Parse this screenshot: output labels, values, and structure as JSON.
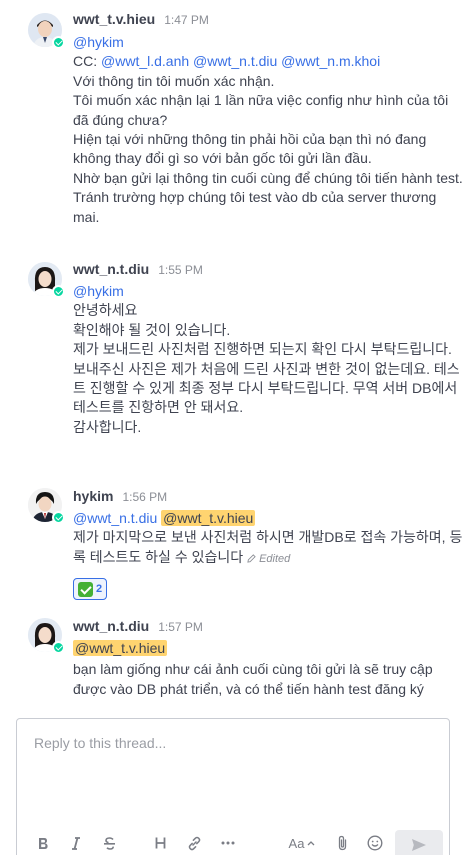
{
  "messages": [
    {
      "author": "wwt_t.v.hieu",
      "time": "1:47 PM",
      "lines": [
        "@hykim",
        "CC: @wwt_l.d.anh @wwt_n.t.diu @wwt_n.m.khoi",
        "Với thông tin tôi muốn xác nhận.",
        "Tôi muốn xác nhận lại 1 lần nữa việc config như hình của tôi đã đúng chưa?",
        "Hiện tại với những thông tin phải hồi của bạn thì nó đang không thay đổi gì so với bản gốc tôi gửi lần đầu.",
        "Nhờ bạn gửi lại thông tin cuối cùng để chúng tôi tiến hành test. Tránh trường hợp chúng tôi test vào db của server thương mai."
      ],
      "mention": "@hykim",
      "cc_label": "CC:",
      "cc_mentions": "@wwt_l.d.anh @wwt_n.t.diu @wwt_n.m.khoi"
    },
    {
      "author": "wwt_n.t.diu",
      "time": "1:55 PM",
      "mention": "@hykim",
      "l1": "안녕하세요",
      "l2": "확인해야 될 것이 있습니다.",
      "l3": "제가 보내드린 사진처럼 진행하면 되는지 확인 다시 부탁드립니다.",
      "l4": "보내주신 사진은 제가 처음에 드린 사진과 변한 것이 없는데요. 테스트 진행할 수 있게 최종 정부 다시 부탁드립니다. 무역 서버 DB에서 테스트를 진항하면 안 돼서요.",
      "l5": "감사합니다."
    },
    {
      "author": "hykim",
      "time": "1:56 PM",
      "mention1": "@wwt_n.t.diu",
      "mention2": "@wwt_t.v.hieu",
      "text": "제가 마지막으로 보낸 사진처럼 하시면 개발DB로 접속 가능하며, 등록 테스트도 하실 수 있습니다",
      "edited": "Edited",
      "reaction_emoji": "white-check-mark",
      "reaction_count": "2"
    },
    {
      "author": "wwt_n.t.diu",
      "time": "1:57 PM",
      "mention": "@wwt_t.v.hieu",
      "text": "bạn làm giống như cái ảnh cuối cùng tôi gửi là sẽ truy cập được vào DB phát triển, và có thể tiến hành test đăng ký"
    }
  ],
  "composer": {
    "placeholder": "Reply to this thread...",
    "font_size_label": "Aa"
  },
  "colors": {
    "mention": "#386fe5",
    "highlight": "#ffd470",
    "online": "#06d6a0"
  }
}
